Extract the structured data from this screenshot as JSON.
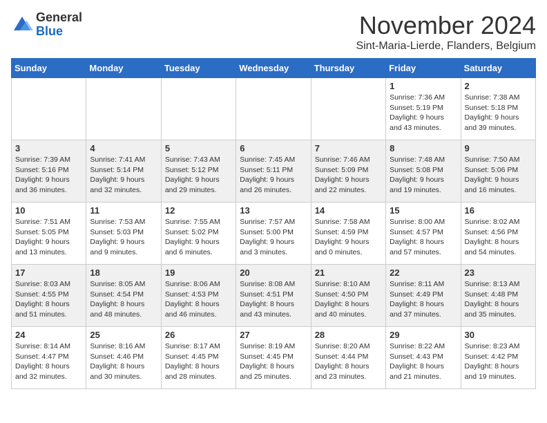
{
  "logo": {
    "general": "General",
    "blue": "Blue"
  },
  "header": {
    "month": "November 2024",
    "location": "Sint-Maria-Lierde, Flanders, Belgium"
  },
  "columns": [
    "Sunday",
    "Monday",
    "Tuesday",
    "Wednesday",
    "Thursday",
    "Friday",
    "Saturday"
  ],
  "weeks": [
    [
      {
        "day": "",
        "info": ""
      },
      {
        "day": "",
        "info": ""
      },
      {
        "day": "",
        "info": ""
      },
      {
        "day": "",
        "info": ""
      },
      {
        "day": "",
        "info": ""
      },
      {
        "day": "1",
        "info": "Sunrise: 7:36 AM\nSunset: 5:19 PM\nDaylight: 9 hours and 43 minutes."
      },
      {
        "day": "2",
        "info": "Sunrise: 7:38 AM\nSunset: 5:18 PM\nDaylight: 9 hours and 39 minutes."
      }
    ],
    [
      {
        "day": "3",
        "info": "Sunrise: 7:39 AM\nSunset: 5:16 PM\nDaylight: 9 hours and 36 minutes."
      },
      {
        "day": "4",
        "info": "Sunrise: 7:41 AM\nSunset: 5:14 PM\nDaylight: 9 hours and 32 minutes."
      },
      {
        "day": "5",
        "info": "Sunrise: 7:43 AM\nSunset: 5:12 PM\nDaylight: 9 hours and 29 minutes."
      },
      {
        "day": "6",
        "info": "Sunrise: 7:45 AM\nSunset: 5:11 PM\nDaylight: 9 hours and 26 minutes."
      },
      {
        "day": "7",
        "info": "Sunrise: 7:46 AM\nSunset: 5:09 PM\nDaylight: 9 hours and 22 minutes."
      },
      {
        "day": "8",
        "info": "Sunrise: 7:48 AM\nSunset: 5:08 PM\nDaylight: 9 hours and 19 minutes."
      },
      {
        "day": "9",
        "info": "Sunrise: 7:50 AM\nSunset: 5:06 PM\nDaylight: 9 hours and 16 minutes."
      }
    ],
    [
      {
        "day": "10",
        "info": "Sunrise: 7:51 AM\nSunset: 5:05 PM\nDaylight: 9 hours and 13 minutes."
      },
      {
        "day": "11",
        "info": "Sunrise: 7:53 AM\nSunset: 5:03 PM\nDaylight: 9 hours and 9 minutes."
      },
      {
        "day": "12",
        "info": "Sunrise: 7:55 AM\nSunset: 5:02 PM\nDaylight: 9 hours and 6 minutes."
      },
      {
        "day": "13",
        "info": "Sunrise: 7:57 AM\nSunset: 5:00 PM\nDaylight: 9 hours and 3 minutes."
      },
      {
        "day": "14",
        "info": "Sunrise: 7:58 AM\nSunset: 4:59 PM\nDaylight: 9 hours and 0 minutes."
      },
      {
        "day": "15",
        "info": "Sunrise: 8:00 AM\nSunset: 4:57 PM\nDaylight: 8 hours and 57 minutes."
      },
      {
        "day": "16",
        "info": "Sunrise: 8:02 AM\nSunset: 4:56 PM\nDaylight: 8 hours and 54 minutes."
      }
    ],
    [
      {
        "day": "17",
        "info": "Sunrise: 8:03 AM\nSunset: 4:55 PM\nDaylight: 8 hours and 51 minutes."
      },
      {
        "day": "18",
        "info": "Sunrise: 8:05 AM\nSunset: 4:54 PM\nDaylight: 8 hours and 48 minutes."
      },
      {
        "day": "19",
        "info": "Sunrise: 8:06 AM\nSunset: 4:53 PM\nDaylight: 8 hours and 46 minutes."
      },
      {
        "day": "20",
        "info": "Sunrise: 8:08 AM\nSunset: 4:51 PM\nDaylight: 8 hours and 43 minutes."
      },
      {
        "day": "21",
        "info": "Sunrise: 8:10 AM\nSunset: 4:50 PM\nDaylight: 8 hours and 40 minutes."
      },
      {
        "day": "22",
        "info": "Sunrise: 8:11 AM\nSunset: 4:49 PM\nDaylight: 8 hours and 37 minutes."
      },
      {
        "day": "23",
        "info": "Sunrise: 8:13 AM\nSunset: 4:48 PM\nDaylight: 8 hours and 35 minutes."
      }
    ],
    [
      {
        "day": "24",
        "info": "Sunrise: 8:14 AM\nSunset: 4:47 PM\nDaylight: 8 hours and 32 minutes."
      },
      {
        "day": "25",
        "info": "Sunrise: 8:16 AM\nSunset: 4:46 PM\nDaylight: 8 hours and 30 minutes."
      },
      {
        "day": "26",
        "info": "Sunrise: 8:17 AM\nSunset: 4:45 PM\nDaylight: 8 hours and 28 minutes."
      },
      {
        "day": "27",
        "info": "Sunrise: 8:19 AM\nSunset: 4:45 PM\nDaylight: 8 hours and 25 minutes."
      },
      {
        "day": "28",
        "info": "Sunrise: 8:20 AM\nSunset: 4:44 PM\nDaylight: 8 hours and 23 minutes."
      },
      {
        "day": "29",
        "info": "Sunrise: 8:22 AM\nSunset: 4:43 PM\nDaylight: 8 hours and 21 minutes."
      },
      {
        "day": "30",
        "info": "Sunrise: 8:23 AM\nSunset: 4:42 PM\nDaylight: 8 hours and 19 minutes."
      }
    ]
  ]
}
